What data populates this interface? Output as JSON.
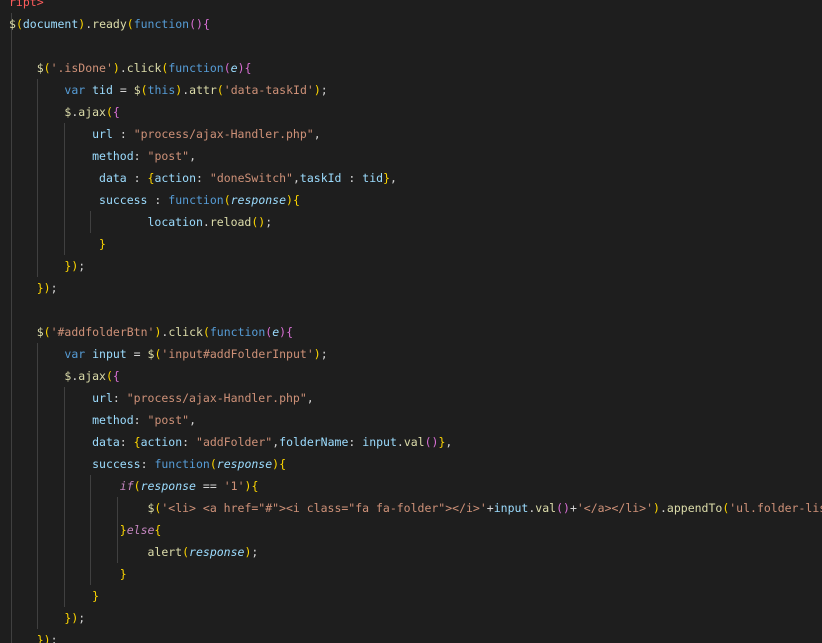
{
  "editor": {
    "language": "javascript",
    "visible_lines": [
      "ript>",
      "$(document).ready(function(){",
      "",
      "    $('.isDone').click(function(e){",
      "        var tid = $(this).attr('data-taskId');",
      "        $.ajax({",
      "            url : \"process/ajax-Handler.php\",",
      "            method: \"post\",",
      "             data : {action: \"doneSwitch\",taskId : tid},",
      "             success : function(response){",
      "                    location.reload();",
      "             }",
      "        });",
      "    });",
      "",
      "    $('#addfolderBtn').click(function(e){",
      "        var input = $('input#addFolderInput');",
      "        $.ajax({",
      "            url: \"process/ajax-Handler.php\",",
      "            method: \"post\",",
      "            data: {action: \"addFolder\",folderName: input.val()},",
      "            success: function(response){",
      "                if(response == '1'){",
      "                    $('<li> <a href=\"#\"><i class=\"fa fa-folder\"></i>'+input.val()+'</a></li>').appendTo('ul.folder-list');",
      "                }else{",
      "                    alert(response);",
      "                }",
      "            }",
      "        });",
      "    });"
    ],
    "colors": {
      "background": "#1e1e1e",
      "default_text": "#d4d4d4",
      "function": "#dcdcaa",
      "string": "#ce9178",
      "keyword": "#569cd6",
      "variable": "#9cdcfe",
      "control": "#c586c0",
      "bracket_1": "#ffd700",
      "bracket_2": "#da70d6",
      "bracket_3": "#179fff"
    }
  }
}
